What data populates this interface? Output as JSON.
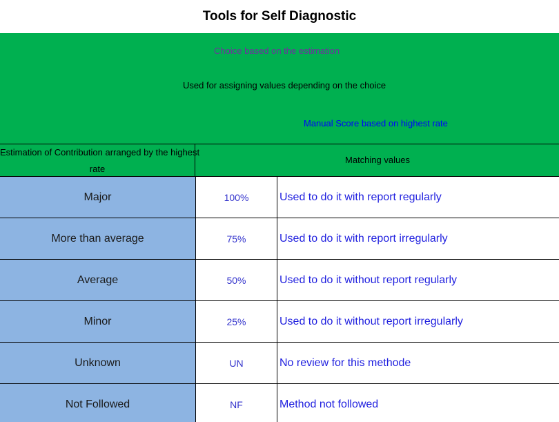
{
  "title": "Tools for Self Diagnostic",
  "legend": {
    "choice": "Choice based on the estimation",
    "used_for": "Used for assigning values depending on the choice",
    "manual": "Manual Score based on highest rate"
  },
  "header": {
    "estimation_line1": "Estimation of Contribution arranged by the highest",
    "estimation_line2": "rate",
    "matching": "Matching values"
  },
  "rows": [
    {
      "estimation": "Major",
      "value": "100%",
      "description": "Used to do it with report regularly"
    },
    {
      "estimation": "More than average",
      "value": "75%",
      "description": "Used to do it with report irregularly"
    },
    {
      "estimation": "Average",
      "value": "50%",
      "description": "Used to do it without report regularly"
    },
    {
      "estimation": "Minor",
      "value": "25%",
      "description": "Used to do it without report irregularly"
    },
    {
      "estimation": "Unknown",
      "value": "UN",
      "description": "No review for this methode"
    },
    {
      "estimation": "Not Followed",
      "value": "NF",
      "description": "Method not followed"
    }
  ],
  "colors": {
    "green": "#00b050",
    "blue_cell": "#8db4e2",
    "purple_text": "#7030a0",
    "blue_text": "#0000ff"
  }
}
